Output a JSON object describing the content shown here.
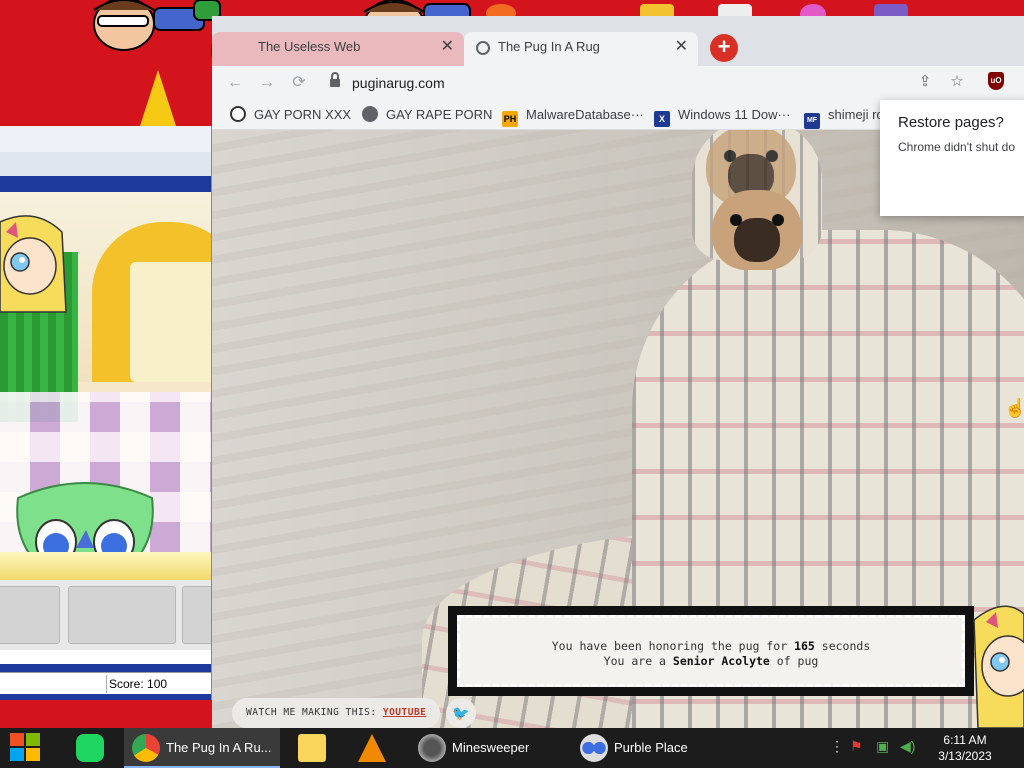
{
  "purble_place": {
    "score_text": "Score: 100"
  },
  "chrome": {
    "tabs": [
      {
        "title": "The Useless Web",
        "close": "✕"
      },
      {
        "title": "The Pug In A Rug",
        "close": "✕"
      }
    ],
    "new_tab": "+",
    "nav": {
      "back": "←",
      "forward": "→",
      "reload": "⟳"
    },
    "url": "puginarug.com",
    "bookmarks": [
      {
        "label": "GAY PORN XXX",
        "icon": "github-icon"
      },
      {
        "label": "GAY RAPE PORN",
        "icon": "globe-icon"
      },
      {
        "label": "MalwareDatabase···",
        "icon": "ph-icon",
        "icon_text": "PH"
      },
      {
        "label": "Windows 11 Dow···",
        "icon": "x-icon",
        "icon_text": "X"
      },
      {
        "label": "shimeji ro",
        "icon": "mf-icon",
        "icon_text": "MF"
      }
    ],
    "restore_popup": {
      "title": "Restore pages?",
      "message": "Chrome didn't shut do"
    }
  },
  "page": {
    "honor_prefix": "You have been honoring the pug for ",
    "seconds": "165",
    "honor_suffix": " seconds",
    "rank_prefix": "You are a ",
    "rank": "Senior Acolyte",
    "rank_suffix": " of pug",
    "watch_label": "WATCH ME MAKING THIS: ",
    "watch_link": "YOUTUBE"
  },
  "taskbar": {
    "apps": [
      {
        "label": "The Pug In A Ru...",
        "icon": "chrome-icon",
        "active": true
      },
      {
        "label": "",
        "icon": "file-explorer-icon"
      },
      {
        "label": "",
        "icon": "vlc-icon"
      },
      {
        "label": "Minesweeper",
        "icon": "minesweeper-icon"
      },
      {
        "label": "Purble Place",
        "icon": "purble-place-icon"
      }
    ],
    "clock_time": "6:11 AM",
    "clock_date": "3/13/2023"
  },
  "colors": {
    "desktop_red": "#d4141d",
    "chrome_tab_strip": "#dee1e6",
    "active_tab": "#f1f3f4",
    "inactive_tab_tint": "#e9b9bd",
    "new_tab_red": "#d93025",
    "link_red": "#c0392b",
    "taskbar": "#1c1c1c"
  }
}
